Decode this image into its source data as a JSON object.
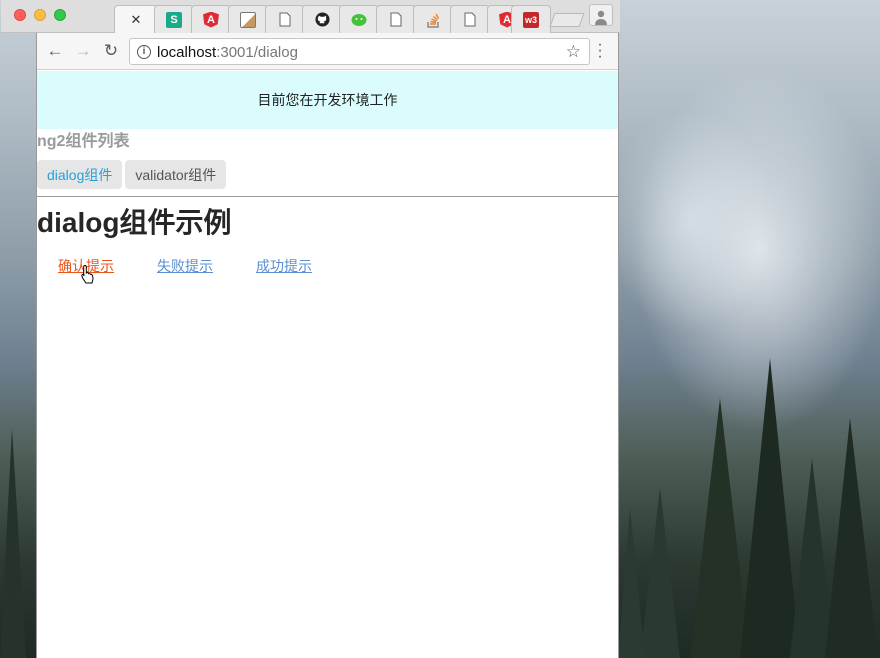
{
  "browser": {
    "tabs": [
      {
        "icon": "page-icon",
        "label": "",
        "active": true,
        "close": "✕"
      },
      {
        "icon": "segmentfault-icon",
        "label": "S"
      },
      {
        "icon": "angular-icon",
        "label": "A"
      },
      {
        "icon": "image-icon",
        "label": ""
      },
      {
        "icon": "document-icon",
        "label": ""
      },
      {
        "icon": "github-icon",
        "label": ""
      },
      {
        "icon": "wechat-icon",
        "label": ""
      },
      {
        "icon": "document-icon",
        "label": ""
      },
      {
        "icon": "stackoverflow-icon",
        "label": ""
      },
      {
        "icon": "document-icon",
        "label": ""
      },
      {
        "icon": "angular-icon",
        "label": "A"
      },
      {
        "icon": "w3-icon",
        "label": "w3"
      }
    ],
    "address": {
      "host": "localhost",
      "path": ":3001/dialog"
    }
  },
  "page": {
    "env_banner": "目前您在开发环境工作",
    "list_title": "ng2组件列表",
    "nav": [
      {
        "label": "dialog组件",
        "active": true
      },
      {
        "label": "validator组件",
        "active": false
      }
    ],
    "demo_title": "dialog组件示例",
    "links": [
      {
        "label": "确认提示",
        "hover": true
      },
      {
        "label": "失败提示",
        "hover": false
      },
      {
        "label": "成功提示",
        "hover": false
      }
    ]
  },
  "colors": {
    "banner_bg": "#dbfcfc",
    "link": "#5b8fd0",
    "link_hover": "#e8551c",
    "nav_active": "#2aa0d8"
  }
}
